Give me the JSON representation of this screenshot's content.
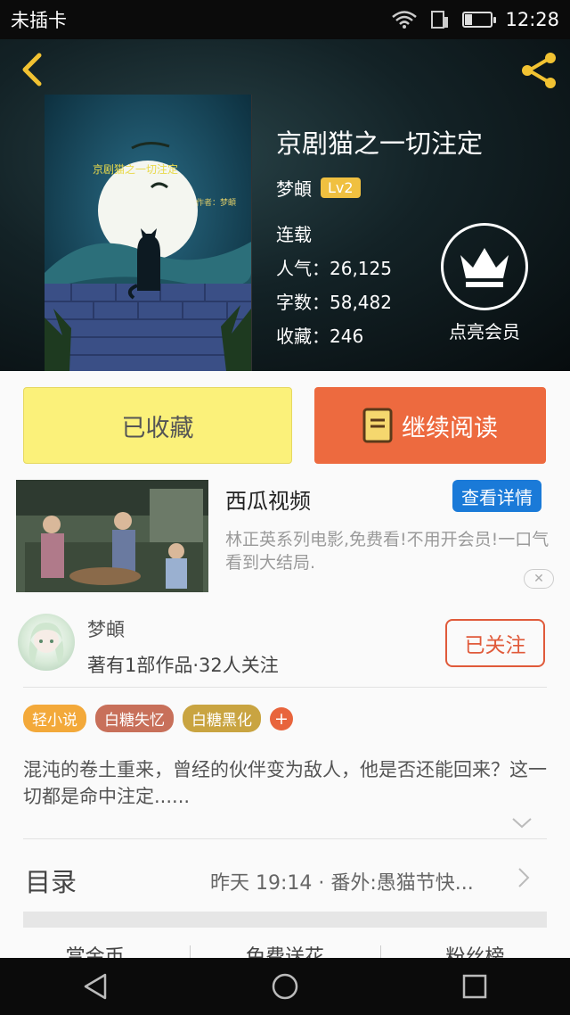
{
  "status_bar": {
    "carrier": "未插卡",
    "time": "12:28"
  },
  "book": {
    "title": "京剧猫之一切注定",
    "author": "梦頔",
    "level": "Lv2",
    "status": "连载",
    "popularity_label": "人气：",
    "popularity": "26,125",
    "word_count_label": "字数：",
    "word_count": "58,482",
    "favorites_label": "收藏：",
    "favorites": "246",
    "cover_title": "京剧猫之一切注定",
    "cover_author": "作者：梦頔"
  },
  "vip": {
    "label": "点亮会员"
  },
  "actions": {
    "collected": "已收藏",
    "continue_read": "继续阅读"
  },
  "ad": {
    "title": "西瓜视频",
    "detail_button": "查看详情",
    "description": "林正英系列电影,免费看!不用开会员!一口气看到大结局."
  },
  "author": {
    "name": "梦頔",
    "stats": "著有1部作品·32人关注",
    "follow_button": "已关注"
  },
  "tags": [
    {
      "label": "轻小说",
      "color": "#f3a93a"
    },
    {
      "label": "白糖失忆",
      "color": "#c8705a"
    },
    {
      "label": "白糖黑化",
      "color": "#c9a441"
    }
  ],
  "synopsis": "混沌的卷土重来，曾经的伙伴变为敌人，他是否还能回来？这一切都是命中注定......",
  "toc": {
    "title": "目录",
    "latest": "昨天 19:14 · 番外:愚猫节快..."
  },
  "bottom_links": [
    "赏金币",
    "免费送花",
    "粉丝榜"
  ],
  "colors": {
    "accent_orange": "#ed6a3f",
    "collected_yellow": "#fbf17a",
    "detail_blue": "#1a7ad8"
  }
}
